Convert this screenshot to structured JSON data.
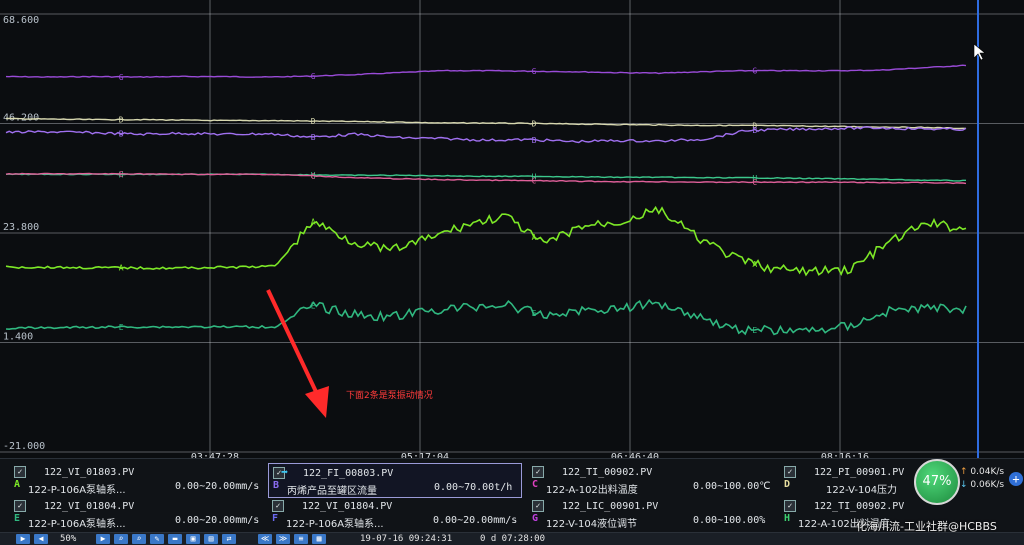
{
  "chart_data": {
    "type": "line",
    "y_tick_labels": [
      "68.600",
      "46.200",
      "23.800",
      "1.400",
      "-21.000"
    ],
    "ylim": [
      -21.0,
      68.6
    ],
    "x_tick_labels": [
      "03:47:28",
      "05:17:04",
      "06:46:40",
      "08:16:16"
    ],
    "grid": true,
    "series": [
      {
        "letter": "G",
        "color": "#9a4bd8",
        "values": [
          55.8,
          55.7,
          55.8,
          55.7,
          55.8,
          55.8,
          55.7,
          55.9,
          56.2,
          56.6,
          57.0,
          57.0,
          56.9,
          56.8,
          56.6,
          56.5,
          56.8,
          57.0,
          57.0,
          57.0,
          57.1,
          57.6,
          58.1
        ]
      },
      {
        "letter": "D",
        "color": "#d8d8b0",
        "values": [
          47.2,
          47.1,
          47.0,
          47.0,
          46.9,
          46.8,
          46.8,
          46.7,
          46.6,
          46.5,
          46.3,
          46.3,
          46.2,
          46.1,
          46.0,
          45.9,
          45.8,
          45.8,
          45.7,
          45.6,
          45.5,
          45.4,
          45.2
        ]
      },
      {
        "letter": "B",
        "color": "#a070f0",
        "values": [
          44.4,
          44.5,
          44.3,
          44.0,
          44.2,
          44.0,
          44.1,
          43.4,
          44.0,
          43.3,
          43.1,
          42.8,
          42.9,
          42.5,
          42.7,
          42.6,
          43.0,
          44.8,
          45.0,
          45.2,
          45.3,
          45.1,
          45.0
        ]
      },
      {
        "letter": "H",
        "color": "#3cc88c",
        "values": [
          35.8,
          35.8,
          35.8,
          35.8,
          35.8,
          35.8,
          35.8,
          35.7,
          35.6,
          35.6,
          35.5,
          35.4,
          35.4,
          35.3,
          35.2,
          35.2,
          35.1,
          35.1,
          35.0,
          34.9,
          34.8,
          34.6,
          34.5
        ]
      },
      {
        "letter": "C",
        "color": "#e0609a",
        "values": [
          35.9,
          35.9,
          35.9,
          35.9,
          35.8,
          35.8,
          35.8,
          35.5,
          35.1,
          34.9,
          34.7,
          34.6,
          34.5,
          34.4,
          34.3,
          34.3,
          34.2,
          34.2,
          34.2,
          34.2,
          34.1,
          34.1,
          34.0
        ]
      },
      {
        "letter": "A",
        "color": "#7de827",
        "values": [
          16.8,
          16.8,
          16.7,
          16.7,
          16.6,
          16.7,
          16.8,
          17.0,
          26.2,
          22.2,
          20.2,
          22.7,
          25.5,
          27.3,
          21.5,
          25.2,
          26.1,
          28.6,
          22.9,
          18.6,
          16.4,
          15.9,
          16.4,
          21.9,
          25.9,
          24.5
        ]
      },
      {
        "letter": "E",
        "color": "#30b880",
        "values": [
          4.3,
          4.4,
          4.5,
          4.6,
          4.6,
          4.6,
          4.6,
          4.6,
          9.0,
          7.2,
          6.6,
          7.9,
          8.6,
          9.2,
          6.9,
          8.0,
          8.4,
          9.5,
          6.9,
          4.1,
          3.9,
          3.8,
          4.9,
          7.9,
          8.5,
          8.3
        ]
      },
      {
        "letter": "F",
        "color": "#5a64f0",
        "values": []
      }
    ]
  },
  "annotation": {
    "text": "下面2条是泵振动情况"
  },
  "legend": [
    {
      "letter": "A",
      "color": "#7de827",
      "tag": "122_VI_01803.PV",
      "desc": "122-P-106A泵轴系...",
      "range": "0.00~20.00mm/s",
      "checked": "✓"
    },
    {
      "letter": "B",
      "color": "#8a6cf0",
      "tag": "122_FI_00803.PV",
      "desc": "丙烯产品至罐区流量",
      "range": "0.00~70.00t/h",
      "checked": "✓"
    },
    {
      "letter": "C",
      "color": "#e040c0",
      "tag": "122_TI_00902.PV",
      "desc": "122-A-102出料温度",
      "range": "0.00~100.00℃",
      "checked": "✓"
    },
    {
      "letter": "D",
      "color": "#e8e0a0",
      "tag": "122_PI_00901.PV",
      "desc": "122-V-104压力",
      "range": "",
      "checked": "✓"
    },
    {
      "letter": "E",
      "color": "#30b880",
      "tag": "122_VI_01804.PV",
      "desc": "122-P-106A泵轴系...",
      "range": "0.00~20.00mm/s",
      "checked": "✓"
    },
    {
      "letter": "F",
      "color": "#6a6af0",
      "tag": "122_VI_01804.PV",
      "desc": "122-P-106A泵轴系...",
      "range": "0.00~20.00mm/s",
      "checked": "✓"
    },
    {
      "letter": "G",
      "color": "#c040e0",
      "tag": "122_LIC_00901.PV",
      "desc": "122-V-104液位调节",
      "range": "0.00~100.00%",
      "checked": "✓"
    },
    {
      "letter": "H",
      "color": "#3cd070",
      "tag": "122_TI_00902.PV",
      "desc": "122-A-102出料温度",
      "range": "0.00~100.00℃",
      "checked": "✓"
    }
  ],
  "status": {
    "cpu": "47%",
    "up": "0.04K/s",
    "down": "0.06K/s",
    "up_arrow": "↑",
    "down_arrow": "↓",
    "plus": "+"
  },
  "toolbar": {
    "zoom": "50%",
    "start_time": "19-07-16 09:24:31",
    "span": "0 d 07:28:00",
    "buttons_left": [
      "▶",
      "◀"
    ],
    "buttons_right": [
      "▶",
      "⌕",
      "⌕",
      "✎",
      "▬",
      "▣",
      "▤",
      "⇄",
      "≪",
      "≫",
      "≡",
      "▦"
    ]
  },
  "watermark": "化海川流-工业社群@HCBBS"
}
